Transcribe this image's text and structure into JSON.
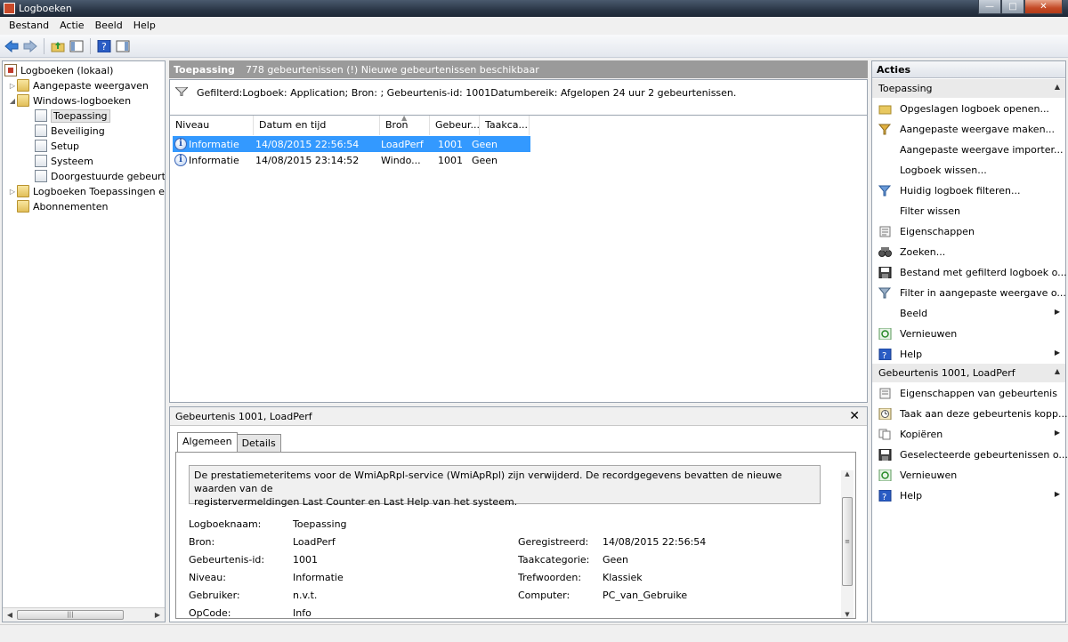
{
  "window": {
    "title": "Logboeken"
  },
  "menu": [
    {
      "label": "Bestand"
    },
    {
      "label": "Actie"
    },
    {
      "label": "Beeld"
    },
    {
      "label": "Help"
    }
  ],
  "tree": {
    "items": [
      {
        "label": "Logboeken (lokaal)",
        "icon": "event-viewer-icon"
      },
      {
        "label": "Aangepaste weergaven",
        "icon": "folder-icon"
      },
      {
        "label": "Windows-logboeken",
        "icon": "folder-icon"
      },
      {
        "label": "Toepassing",
        "icon": "log-icon"
      },
      {
        "label": "Beveiliging",
        "icon": "log-icon"
      },
      {
        "label": "Setup",
        "icon": "log-icon"
      },
      {
        "label": "Systeem",
        "icon": "log-icon"
      },
      {
        "label": "Doorgestuurde gebeurtenissen",
        "icon": "log-icon"
      },
      {
        "label": "Logboeken Toepassingen en services",
        "icon": "folder-icon"
      },
      {
        "label": "Abonnementen",
        "icon": "subscriptions-icon"
      }
    ]
  },
  "center": {
    "header_title": "Toepassing",
    "header_info": "778 gebeurtenissen (!) Nieuwe gebeurtenissen beschikbaar",
    "filter_text": "Gefilterd:Logboek: Application; Bron: ; Gebeurtenis-id: 1001Datumbereik: Afgelopen 24 uur 2 gebeurtenissen.",
    "columns": [
      "Niveau",
      "Datum en tijd",
      "Bron",
      "Gebeur...",
      "Taakca..."
    ],
    "rows": [
      {
        "niveau": "Informatie",
        "datum": "14/08/2015 22:56:54",
        "bron": "LoadPerf",
        "id": "1001",
        "taak": "Geen"
      },
      {
        "niveau": "Informatie",
        "datum": "14/08/2015 23:14:52",
        "bron": "Windo...",
        "id": "1001",
        "taak": "Geen"
      }
    ]
  },
  "detail": {
    "title": "Gebeurtenis 1001, LoadPerf",
    "tabs": [
      "Algemeen",
      "Details"
    ],
    "description_line1": "De prestatiemeteritems voor de WmiApRpl-service (WmiApRpl) zijn verwijderd. De recordgegevens bevatten de nieuwe waarden van de",
    "description_line2": "registervermeldingen Last Counter en Last Help van het systeem.",
    "fields": {
      "logboeknaam_label": "Logboeknaam:",
      "logboeknaam": "Toepassing",
      "bron_label": "Bron:",
      "bron": "LoadPerf",
      "geregistreerd_label": "Geregistreerd:",
      "geregistreerd": "14/08/2015 22:56:54",
      "id_label": "Gebeurtenis-id:",
      "id": "1001",
      "taak_label": "Taakcategorie:",
      "taak": "Geen",
      "niveau_label": "Niveau:",
      "niveau": "Informatie",
      "trefwoorden_label": "Trefwoorden:",
      "trefwoorden": "Klassiek",
      "gebruiker_label": "Gebruiker:",
      "gebruiker": "n.v.t.",
      "computer_label": "Computer:",
      "computer": "PC_van_Gebruike",
      "opcode_label": "OpCode:",
      "opcode": "Info"
    }
  },
  "actions": {
    "header": "Acties",
    "group1": "Toepassing",
    "group1_items": [
      "Opgeslagen logboek openen...",
      "Aangepaste weergave maken...",
      "Aangepaste weergave importer...",
      "Logboek wissen...",
      "Huidig logboek filteren...",
      "Filter wissen",
      "Eigenschappen",
      "Zoeken...",
      "Bestand met gefilterd logboek o...",
      "Filter in aangepaste weergave o...",
      "Beeld",
      "Vernieuwen",
      "Help"
    ],
    "group2": "Gebeurtenis 1001, LoadPerf",
    "group2_items": [
      "Eigenschappen van gebeurtenis",
      "Taak aan deze gebeurtenis kopp...",
      "Kopiëren",
      "Geselecteerde gebeurtenissen o...",
      "Vernieuwen",
      "Help"
    ]
  },
  "colors": {
    "selection": "#3399ff",
    "header_gray": "#9a9a9a",
    "info_blue": "#3a66b8"
  }
}
